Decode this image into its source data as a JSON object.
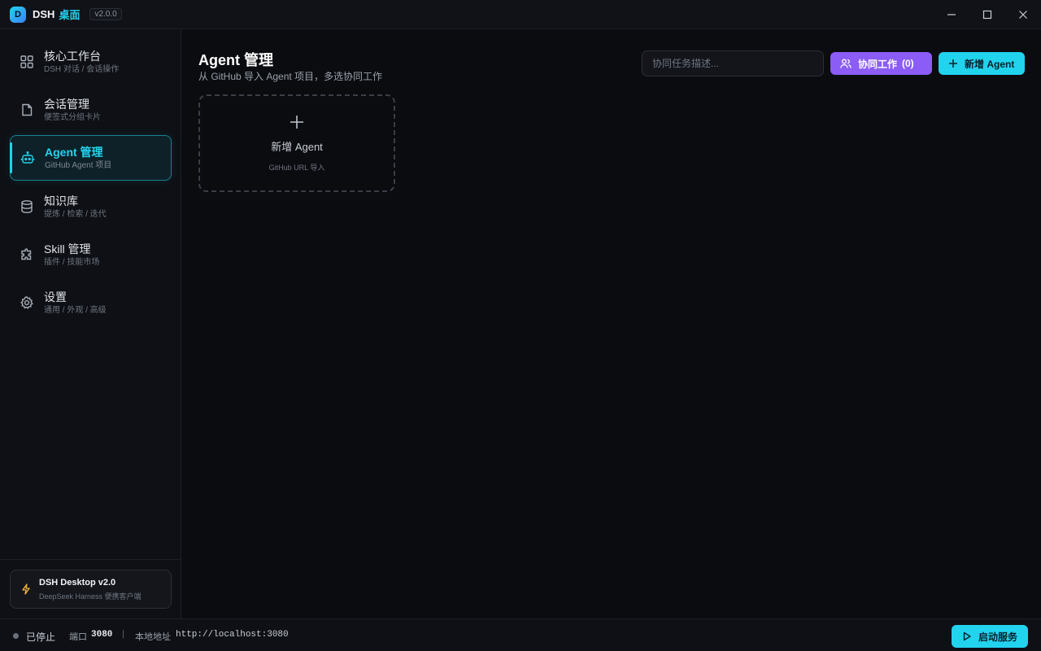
{
  "titlebar": {
    "logo_letter": "D",
    "app_name": "DSH",
    "app_name_accent": "桌面",
    "version": "v2.0.0",
    "controls": [
      "minimize-icon",
      "maximize-icon",
      "close-icon"
    ]
  },
  "sidebar": {
    "items": [
      {
        "label": "核心工作台",
        "sub": "DSH 对话 / 会话操作",
        "icon": "grid-icon"
      },
      {
        "label": "会话管理",
        "sub": "便签式分组卡片",
        "icon": "file-icon"
      },
      {
        "label": "Agent 管理",
        "sub": "GitHub Agent 项目",
        "icon": "bot-icon"
      },
      {
        "label": "知识库",
        "sub": "提炼 / 检索 / 迭代",
        "icon": "database-icon"
      },
      {
        "label": "Skill 管理",
        "sub": "插件 / 技能市场",
        "icon": "puzzle-icon"
      },
      {
        "label": "设置",
        "sub": "通用 / 外观 / 高级",
        "icon": "gear-icon"
      }
    ],
    "active_item": "Agent 管理",
    "footer": {
      "title": "DSH Desktop v2.0",
      "subtitle": "DeepSeek Harness 便携客户端",
      "icon": "bolt-icon"
    }
  },
  "main": {
    "title": "Agent 管理",
    "subtitle": "从 GitHub 导入 Agent 项目，多选协同工作",
    "search_placeholder": "协同任务描述...",
    "collab_button": {
      "label": "协同工作",
      "count": "(0)",
      "icon": "users-icon"
    },
    "new_button": {
      "label": "新增 Agent",
      "icon": "plus-icon"
    },
    "add_card": {
      "title": "新增 Agent",
      "hint": "GitHub URL 导入",
      "icon": "plus-icon"
    }
  },
  "statusbar": {
    "status": "已停止",
    "port_label": "端口",
    "port": "3080",
    "separator": "|",
    "address_label": "本地地址",
    "address": "http://localhost:3080",
    "start_button": {
      "label": "启动服务",
      "icon": "play-icon"
    }
  },
  "colors": {
    "accent": "#22d3ee",
    "purple": "#8b5cf6",
    "background": "#0b0c10",
    "sidebar": "#0e1015",
    "warning": "#f5b73b",
    "status_stopped": "#6b717b"
  }
}
